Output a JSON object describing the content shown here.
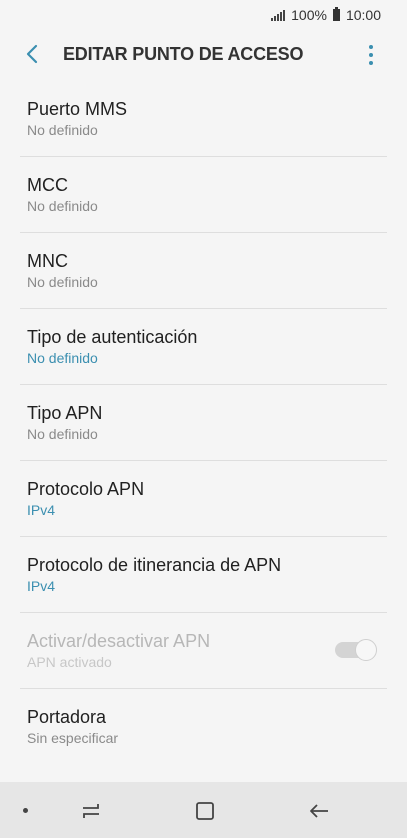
{
  "status_bar": {
    "battery_percent": "100%",
    "time": "10:00",
    "icons": [
      "signal-icon",
      "battery-icon"
    ]
  },
  "app_bar": {
    "title": "EDITAR PUNTO DE ACCESO",
    "back_icon": "chevron-left-icon",
    "menu_icon": "more-vert-icon",
    "accent_color": "#3b8fb0"
  },
  "settings": [
    {
      "label": "Puerto MMS",
      "value": "No definido",
      "accent": false
    },
    {
      "label": "MCC",
      "value": "No definido",
      "accent": false
    },
    {
      "label": "MNC",
      "value": "No definido",
      "accent": false
    },
    {
      "label": "Tipo de autenticación",
      "value": "No definido",
      "accent": true
    },
    {
      "label": "Tipo APN",
      "value": "No definido",
      "accent": false
    },
    {
      "label": "Protocolo APN",
      "value": "IPv4",
      "accent": true
    },
    {
      "label": "Protocolo de itinerancia de APN",
      "value": "IPv4",
      "accent": true
    },
    {
      "label": "Activar/desactivar APN",
      "value": "APN activado",
      "accent": false,
      "disabled": true,
      "toggle_on": true
    },
    {
      "label": "Portadora",
      "value": "Sin especificar",
      "accent": false
    }
  ],
  "nav_bar": {
    "icons": [
      "dot-icon",
      "recents-icon",
      "home-icon",
      "back-icon"
    ]
  }
}
